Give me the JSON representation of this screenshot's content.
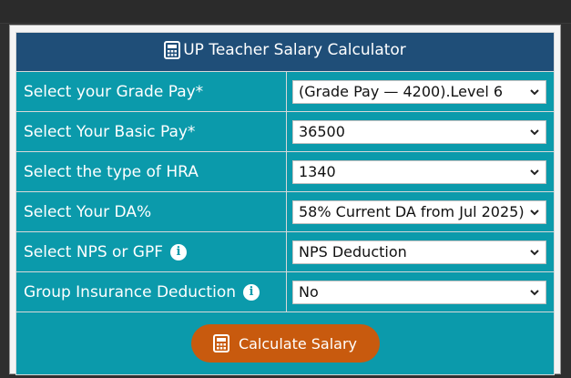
{
  "header": {
    "title": "UP Teacher Salary Calculator",
    "icon": "calculator-icon"
  },
  "fields": [
    {
      "label": "Select your Grade Pay*",
      "value": "(Grade Pay — 4200).Level 6",
      "info": false
    },
    {
      "label": "Select Your Basic Pay*",
      "value": "36500",
      "info": false
    },
    {
      "label": "Select the type of HRA",
      "value": "1340",
      "info": false
    },
    {
      "label": "Select Your DA%",
      "value": "58% Current DA from Jul 2025)",
      "info": false
    },
    {
      "label": "Select NPS or GPF",
      "value": "NPS Deduction",
      "info": true
    },
    {
      "label": "Group Insurance Deduction",
      "value": "No",
      "info": true
    }
  ],
  "actions": {
    "calculate_label": "Calculate Salary",
    "calculate_icon": "calculator-icon"
  },
  "colors": {
    "header_bg": "#1f4e78",
    "row_bg": "#0b9aab",
    "button_bg": "#c85a0e",
    "text_light": "#ffffff"
  }
}
